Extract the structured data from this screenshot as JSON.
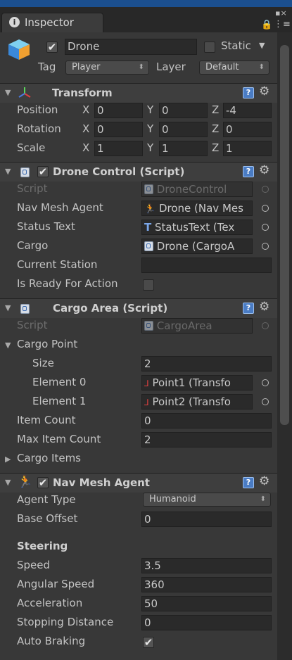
{
  "window": {
    "tab_title": "Inspector"
  },
  "object": {
    "enabled": true,
    "name": "Drone",
    "static_label": "Static",
    "tag_label": "Tag",
    "tag_value": "Player",
    "layer_label": "Layer",
    "layer_value": "Default"
  },
  "transform": {
    "title": "Transform",
    "rows": [
      {
        "label": "Position",
        "x": "0",
        "y": "0",
        "z": "-4"
      },
      {
        "label": "Rotation",
        "x": "0",
        "y": "0",
        "z": "0"
      },
      {
        "label": "Scale",
        "x": "1",
        "y": "1",
        "z": "1"
      }
    ],
    "axis": {
      "x": "X",
      "y": "Y",
      "z": "Z"
    }
  },
  "drone_control": {
    "title": "Drone Control (Script)",
    "enabled": true,
    "rows": [
      {
        "label": "Script",
        "value": "DroneControl"
      },
      {
        "label": "Nav Mesh Agent",
        "value": "Drone (Nav Mes"
      },
      {
        "label": "Status Text",
        "value": "StatusText (Tex"
      },
      {
        "label": "Cargo",
        "value": "Drone (CargoA"
      },
      {
        "label": "Current Station",
        "value": ""
      },
      {
        "label": "Is Ready For Action",
        "value": ""
      }
    ]
  },
  "cargo_area": {
    "title": "Cargo Area (Script)",
    "rows": [
      {
        "label": "Script",
        "value": "CargoArea"
      },
      {
        "label": "Cargo Point",
        "value": ""
      },
      {
        "label": "Size",
        "value": "2"
      },
      {
        "label": "Element 0",
        "value": "Point1 (Transfo"
      },
      {
        "label": "Element 1",
        "value": "Point2 (Transfo"
      },
      {
        "label": "Item Count",
        "value": "0"
      },
      {
        "label": "Max Item Count",
        "value": "2"
      },
      {
        "label": "Cargo Items",
        "value": ""
      }
    ]
  },
  "nav_mesh_agent": {
    "title": "Nav Mesh Agent",
    "enabled": true,
    "agent_type_label": "Agent Type",
    "agent_type_value": "Humanoid",
    "base_offset_label": "Base Offset",
    "base_offset_value": "0",
    "steering_title": "Steering",
    "rows": [
      {
        "label": "Speed",
        "value": "3.5"
      },
      {
        "label": "Angular Speed",
        "value": "360"
      },
      {
        "label": "Acceleration",
        "value": "50"
      },
      {
        "label": "Stopping Distance",
        "value": "0"
      },
      {
        "label": "Auto Braking",
        "value": ""
      }
    ],
    "auto_braking": true
  },
  "colors": {
    "background": "#383838",
    "field": "#2a2a2a",
    "accent_title_bar": "#1b4f8f"
  }
}
